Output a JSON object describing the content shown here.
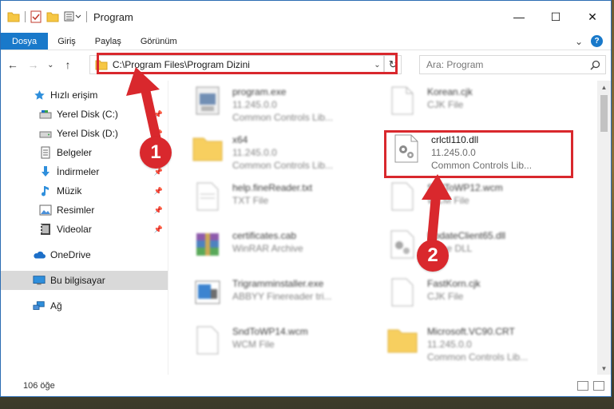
{
  "window": {
    "title": "Program",
    "minimize": "—",
    "maximize": "☐",
    "close": "✕"
  },
  "ribbon": {
    "tabs": [
      "Dosya",
      "Giriş",
      "Paylaş",
      "Görünüm"
    ],
    "expand": "⌄",
    "help": "?"
  },
  "nav": {
    "back": "←",
    "forward": "→",
    "recent": "⌄",
    "up": "↑",
    "address": "C:\\Program Files\\Program Dizini",
    "dropdown": "⌄",
    "refresh": "↻",
    "search_placeholder": "Ara: Program"
  },
  "sidebar": {
    "items": [
      {
        "label": "Hızlı erişim",
        "icon": "star-icon"
      },
      {
        "label": "Yerel Disk (C:)",
        "icon": "drive-icon",
        "pinned": true
      },
      {
        "label": "Yerel Disk (D:)",
        "icon": "drive-icon",
        "pinned": true
      },
      {
        "label": "Belgeler",
        "icon": "documents-icon",
        "pinned": true
      },
      {
        "label": "İndirmeler",
        "icon": "download-icon",
        "pinned": true
      },
      {
        "label": "Müzik",
        "icon": "music-icon",
        "pinned": true
      },
      {
        "label": "Resimler",
        "icon": "pictures-icon",
        "pinned": true
      },
      {
        "label": "Videolar",
        "icon": "video-icon",
        "pinned": true
      },
      {
        "label": "OneDrive",
        "icon": "cloud-icon"
      },
      {
        "label": "Bu bilgisayar",
        "icon": "computer-icon",
        "selected": true
      },
      {
        "label": "Ağ",
        "icon": "network-icon"
      }
    ]
  },
  "files": [
    {
      "name": "program.exe",
      "sub1": "11.245.0.0",
      "sub2": "Common Controls Lib...",
      "icon": "exe-icon"
    },
    {
      "name": "Korean.cjk",
      "sub1": "CJK File",
      "sub2": "",
      "icon": "blank-file-icon"
    },
    {
      "name": "x64",
      "sub1": "11.245.0.0",
      "sub2": "Common Controls Lib...",
      "icon": "folder-icon"
    },
    {
      "name": "crlctl110.dll",
      "sub1": "11.245.0.0",
      "sub2": "Common Controls Lib...",
      "icon": "dll-gear-icon",
      "highlighted": true
    },
    {
      "name": "help.fineReader.txt",
      "sub1": "TXT File",
      "sub2": "",
      "icon": "text-file-icon"
    },
    {
      "name": "SndToWP12.wcm",
      "sub1": "WCM File",
      "sub2": "",
      "icon": "blank-file-icon"
    },
    {
      "name": "certificates.cab",
      "sub1": "WinRAR Archive",
      "sub2": "",
      "icon": "archive-icon"
    },
    {
      "name": "UpdateClient65.dll",
      "sub1": "Office DLL",
      "sub2": "",
      "icon": "dll-gear-icon"
    },
    {
      "name": "Trigramminstaller.exe",
      "sub1": "ABBYY Finereader tri...",
      "sub2": "",
      "icon": "installer-icon"
    },
    {
      "name": "FastKorn.cjk",
      "sub1": "CJK File",
      "sub2": "",
      "icon": "blank-file-icon"
    },
    {
      "name": "SndToWP14.wcm",
      "sub1": "WCM File",
      "sub2": "",
      "icon": "blank-file-icon"
    },
    {
      "name": "Microsoft.VC90.CRT",
      "sub1": "11.245.0.0",
      "sub2": "Common Controls Lib...",
      "icon": "folder-icon"
    }
  ],
  "annotations": {
    "badge1": "1",
    "badge2": "2"
  },
  "status": {
    "count": "106 öğe"
  },
  "colors": {
    "accent": "#1979ca",
    "annotation": "#d9282d",
    "folder": "#f6c744"
  }
}
